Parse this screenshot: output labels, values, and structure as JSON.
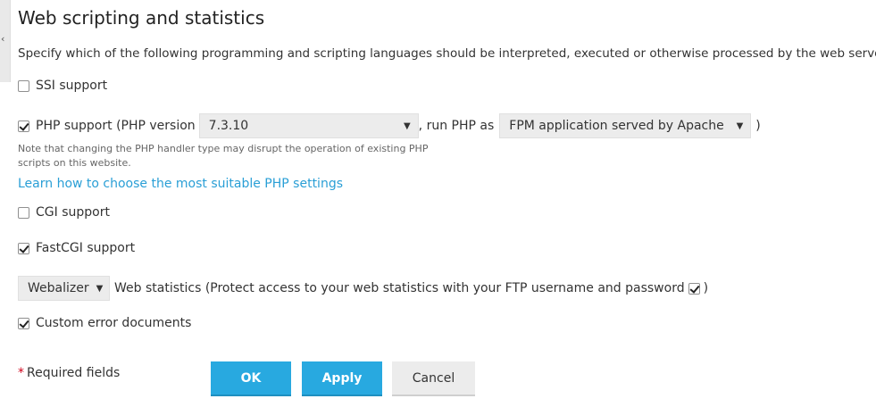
{
  "section": {
    "title": "Web scripting and statistics",
    "description": "Specify which of the following programming and scripting languages should be interpreted, executed or otherwise processed by the web server."
  },
  "ssi": {
    "label": "SSI support",
    "checked": false
  },
  "php": {
    "label_before": "PHP support (PHP version",
    "version_value": "7.3.10",
    "run_as_label": ", run PHP as",
    "handler_value": "FPM application served by Apache",
    "close_paren": ")",
    "checked": true,
    "note": "Note that changing the PHP handler type may disrupt the operation of existing PHP scripts on this website.",
    "learn_link": "Learn how to choose the most suitable PHP settings"
  },
  "cgi": {
    "label": "CGI support",
    "checked": false
  },
  "fastcgi": {
    "label": "FastCGI support",
    "checked": true
  },
  "stats": {
    "select_value": "Webalizer",
    "label": "Web statistics (Protect access to your web statistics with your FTP username and password",
    "close_paren": ")",
    "protect_checked": true
  },
  "custom_errors": {
    "label": "Custom error documents",
    "checked": true
  },
  "footer": {
    "required_star": "*",
    "required_label": "Required fields",
    "ok_label": "OK",
    "apply_label": "Apply",
    "cancel_label": "Cancel"
  },
  "colors": {
    "primary_button": "#28a9e0",
    "link": "#2a9fd6",
    "required_star": "#d0021b"
  },
  "icons": {
    "collapse": "chevron-left-icon",
    "dropdown": "caret-down-icon",
    "check": "checkmark-icon"
  }
}
